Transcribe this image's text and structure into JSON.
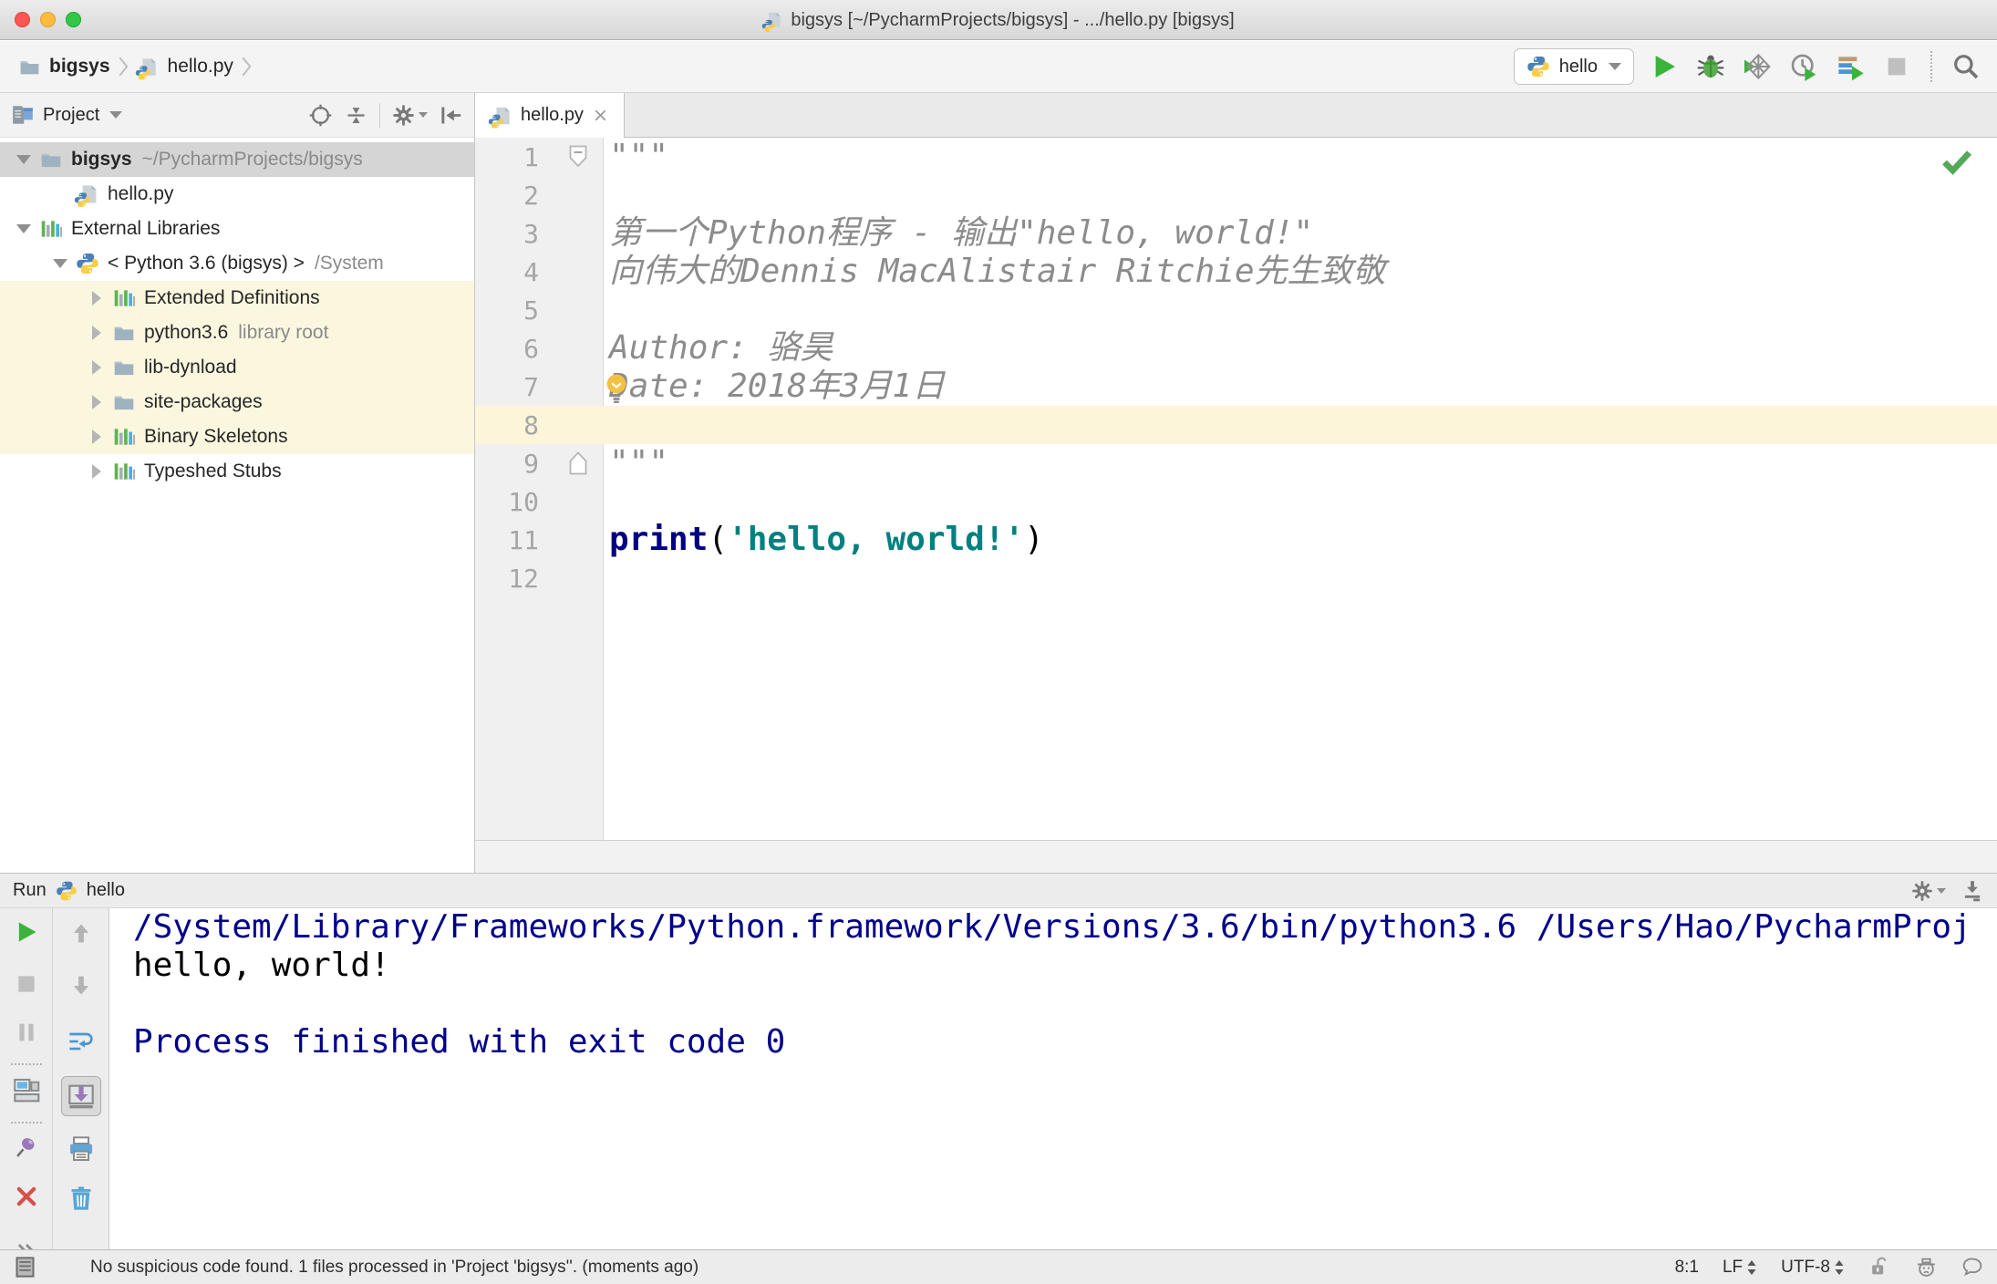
{
  "colors": {
    "run_green": "#3bb33b",
    "error_red": "#d6504c",
    "pin_purple": "#9b79b8",
    "keyword_navy": "#000080",
    "string_teal": "#008080",
    "doc_gray": "#8c8c8c",
    "console_system_navy": "#00008b",
    "current_line_yellow": "#fcf5da",
    "tree_highlight_yellow": "#fbf7df",
    "selection_gray": "#d5d5d5"
  },
  "title_bar": {
    "title": "bigsys [~/PycharmProjects/bigsys] - .../hello.py [bigsys]"
  },
  "toolbar": {
    "breadcrumbs": [
      {
        "label": "bigsys",
        "icon": "folder",
        "bold": true
      },
      {
        "label": "hello.py",
        "icon": "pyfile",
        "bold": false
      }
    ],
    "run_config": {
      "label": "hello"
    }
  },
  "project_panel": {
    "header": {
      "title": "Project"
    },
    "tree": [
      {
        "label": "bigsys",
        "suffix": "~/PycharmProjects/bigsys",
        "icon": "folder",
        "arrow": "down",
        "indent": 0,
        "selected": true,
        "bold": true
      },
      {
        "label": "hello.py",
        "icon": "pyfile",
        "arrow": null,
        "indent": 1
      },
      {
        "label": "External Libraries",
        "icon": "library",
        "arrow": "down",
        "indent": 0
      },
      {
        "label": "< Python 3.6 (bigsys) >",
        "suffix": "/System",
        "icon": "python",
        "arrow": "down",
        "indent": 1
      },
      {
        "label": "Extended Definitions",
        "icon": "library",
        "arrow": "right",
        "indent": 2,
        "highlight": true
      },
      {
        "label": "python3.6",
        "suffix": "library root",
        "icon": "folder",
        "arrow": "right",
        "indent": 2,
        "highlight": true
      },
      {
        "label": "lib-dynload",
        "icon": "folder",
        "arrow": "right",
        "indent": 2,
        "highlight": true
      },
      {
        "label": "site-packages",
        "icon": "folder",
        "arrow": "right",
        "indent": 2,
        "highlight": true
      },
      {
        "label": "Binary Skeletons",
        "icon": "library",
        "arrow": "right",
        "indent": 2,
        "highlight": true
      },
      {
        "label": "Typeshed Stubs",
        "icon": "library",
        "arrow": "right",
        "indent": 2
      }
    ]
  },
  "editor": {
    "tab": {
      "label": "hello.py"
    },
    "lines": [
      {
        "n": 1,
        "fold": "start",
        "segments": [
          {
            "t": "\"\"\"",
            "c": "doc"
          }
        ]
      },
      {
        "n": 2,
        "segments": []
      },
      {
        "n": 3,
        "segments": [
          {
            "t": "第一个Python程序 - 输出\"hello, world!\"",
            "c": "doc"
          }
        ]
      },
      {
        "n": 4,
        "segments": [
          {
            "t": "向伟大的Dennis MacAlistair Ritchie先生致敬",
            "c": "doc"
          }
        ]
      },
      {
        "n": 5,
        "segments": []
      },
      {
        "n": 6,
        "segments": [
          {
            "t": "Author: 骆昊",
            "c": "doc"
          }
        ]
      },
      {
        "n": 7,
        "bulb": true,
        "segments": [
          {
            "t": "Date: 2018年3月1日",
            "c": "doc"
          }
        ]
      },
      {
        "n": 8,
        "current": true,
        "segments": []
      },
      {
        "n": 9,
        "fold": "end",
        "segments": [
          {
            "t": "\"\"\"",
            "c": "doc"
          }
        ]
      },
      {
        "n": 10,
        "segments": []
      },
      {
        "n": 11,
        "segments": [
          {
            "t": "print",
            "c": "kw"
          },
          {
            "t": "(",
            "c": "plain"
          },
          {
            "t": "'hello, world!'",
            "c": "str"
          },
          {
            "t": ")",
            "c": "plain"
          }
        ]
      },
      {
        "n": 12,
        "segments": []
      }
    ]
  },
  "run_panel": {
    "title": "Run",
    "config_label": "hello",
    "console": [
      {
        "text": "/System/Library/Frameworks/Python.framework/Versions/3.6/bin/python3.6 /Users/Hao/PycharmProj",
        "style": "system"
      },
      {
        "text": "hello, world!",
        "style": "stdout"
      },
      {
        "text": "",
        "style": "stdout"
      },
      {
        "text": "Process finished with exit code 0",
        "style": "system"
      }
    ]
  },
  "status_bar": {
    "message": "No suspicious code found. 1 files processed in 'Project 'bigsys''. (moments ago)",
    "caret_position": "8:1",
    "line_separator": "LF",
    "encoding": "UTF-8"
  }
}
